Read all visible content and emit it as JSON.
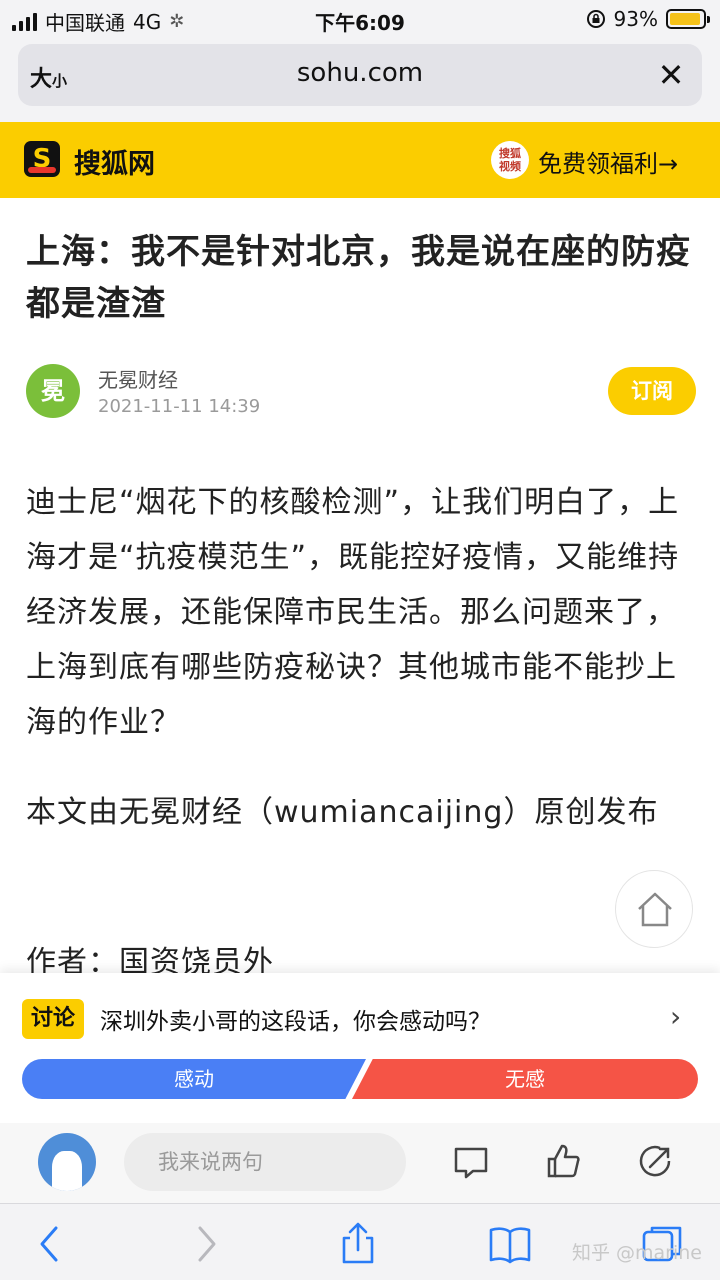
{
  "status_bar": {
    "carrier": "中国联通",
    "network": "4G",
    "time": "下午6:09",
    "battery": "93%",
    "battery_level": 0.93,
    "battery_color": "#f5c21a"
  },
  "url_bar": {
    "text_size_label": "大",
    "text_size_small": "小",
    "url": "sohu.com"
  },
  "site_header": {
    "logo_letter": "S",
    "site_name": "搜狐网",
    "video_badge_top": "搜狐",
    "video_badge_bottom": "视频",
    "promo": "免费领福利→",
    "accent": "#fbcd00"
  },
  "article": {
    "title": "上海：我不是针对北京，我是说在座的防疫都是渣渣",
    "author_avatar_char": "冕",
    "author": "无冕财经",
    "date": "2021-11-11 14:39",
    "follow_label": "订阅",
    "paragraphs": [
      "迪士尼“烟花下的核酸检测”，让我们明白了，上海才是“抗疫模范生”，既能控好疫情，又能维持经济发展，还能保障市民生活。那么问题来了，上海到底有哪些防疫秘诀？其他城市能不能抄上海的作业？",
      "本文由无冕财经（wumiancaijing）原创发布",
      "作者：国资饶员外"
    ]
  },
  "discussion": {
    "badge": "讨论",
    "question": "深圳外卖小哥的这段话，你会感动吗？",
    "option_left": "感动",
    "option_right": "无感",
    "left_color": "#4a7ff5",
    "right_color": "#f55446"
  },
  "comment_bar": {
    "placeholder": "我来说两句"
  },
  "watermark": "知乎 @marine",
  "icons": [
    "signal-icon",
    "loading-icon",
    "lock-rotation-icon",
    "battery-icon",
    "close-icon",
    "home-icon",
    "chevron-right-icon",
    "comment-icon",
    "thumbs-up-icon",
    "share-icon",
    "back-icon",
    "forward-icon",
    "share-sheet-icon",
    "bookmarks-icon",
    "tabs-icon"
  ]
}
